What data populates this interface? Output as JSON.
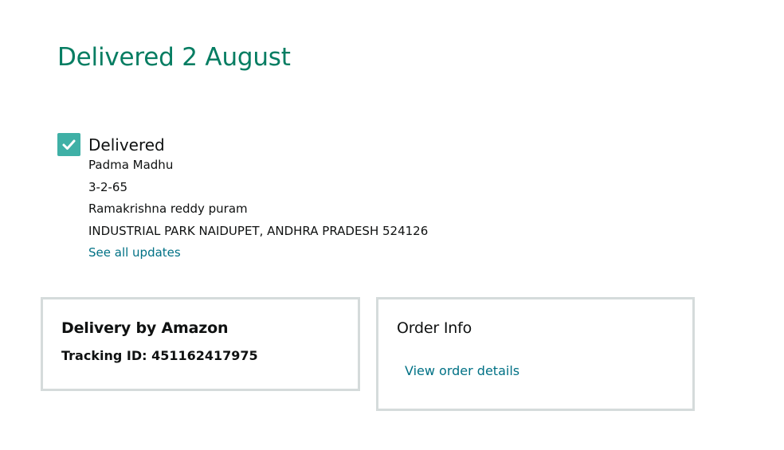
{
  "header": {
    "title": "Delivered 2 August"
  },
  "status": {
    "label": "Delivered",
    "icon": "check-icon",
    "icon_color": "#3fb0a6",
    "address": {
      "name": "Padma Madhu",
      "line1": "3-2-65",
      "line2": "Ramakrishna reddy puram",
      "line3": "INDUSTRIAL PARK NAIDUPET, ANDHRA PRADESH 524126"
    },
    "see_all_link": "See all updates"
  },
  "delivery_card": {
    "title": "Delivery by Amazon",
    "tracking_label": "Tracking ID: 451162417975"
  },
  "order_card": {
    "title": "Order Info",
    "link": "View order details"
  },
  "colors": {
    "headline": "#067d62",
    "link": "#007185",
    "card_border": "#d5dbdb"
  }
}
